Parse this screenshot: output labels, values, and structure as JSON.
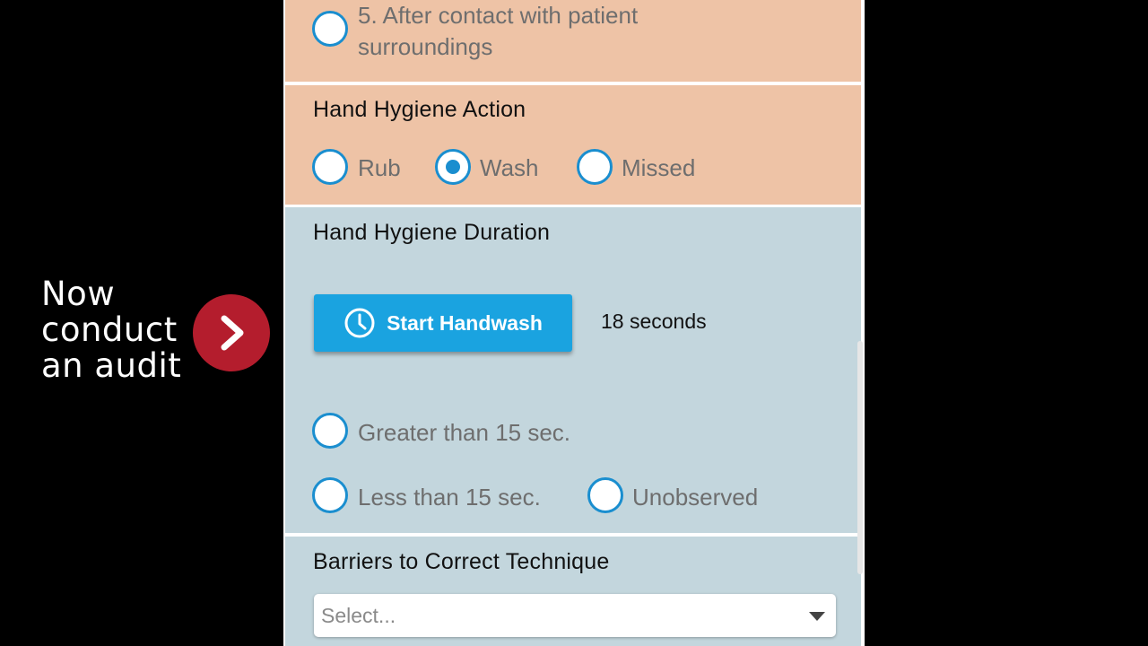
{
  "callout": {
    "lines": [
      "Now",
      "conduct",
      "an audit"
    ],
    "arrow_icon": "chevron-right-icon",
    "arrow_color": "#b41d2d"
  },
  "moments": {
    "option5_label_line1": "5. After contact with patient",
    "option5_label_line2": "surroundings"
  },
  "action": {
    "title": "Hand Hygiene Action",
    "options": [
      {
        "label": "Rub",
        "checked": false
      },
      {
        "label": "Wash",
        "checked": true
      },
      {
        "label": "Missed",
        "checked": false
      }
    ]
  },
  "duration": {
    "title": "Hand Hygiene Duration",
    "button_label": "Start Handwash",
    "button_icon": "clock-icon",
    "elapsed_text": "18 seconds",
    "options": [
      {
        "label": "Greater than 15 sec.",
        "checked": false
      },
      {
        "label": "Less than 15 sec.",
        "checked": false
      },
      {
        "label": "Unobserved",
        "checked": false
      }
    ]
  },
  "barriers": {
    "title": "Barriers to Correct Technique",
    "placeholder": "Select..."
  },
  "colors": {
    "orange_section": "#eec3a6",
    "blue_section": "#c3d6dd",
    "accent": "#1a8ecf",
    "button": "#1aa3e0"
  }
}
